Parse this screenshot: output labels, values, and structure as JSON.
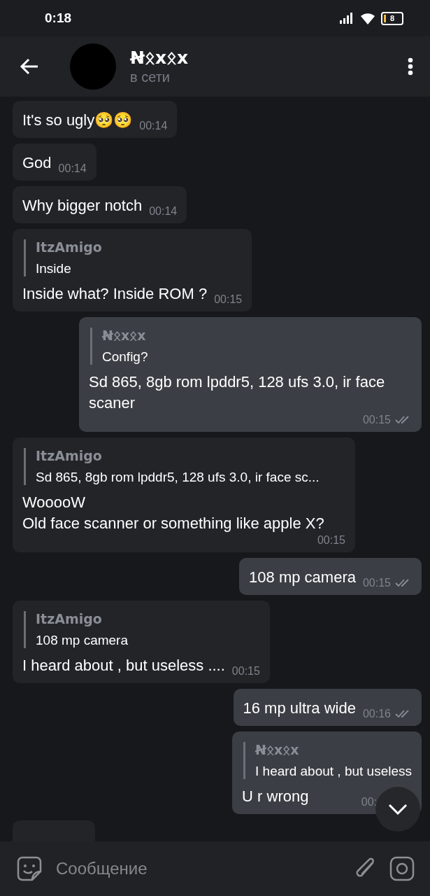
{
  "status_bar": {
    "time": "0:18",
    "battery": "8"
  },
  "header": {
    "name": "Ꞥᛟxᛟx",
    "status": "в сети"
  },
  "messages": [
    {
      "kind": "in",
      "text": "It's so ugly🥺🥺",
      "time": "00:14"
    },
    {
      "kind": "in",
      "text": "God",
      "time": "00:14"
    },
    {
      "kind": "in",
      "text": "Why bigger notch",
      "time": "00:14"
    },
    {
      "kind": "in",
      "reply": {
        "name": "ItzAmigo",
        "text": "Inside"
      },
      "text": "Inside what? Inside ROM ?",
      "time": "00:15"
    },
    {
      "kind": "out",
      "reply": {
        "name": "Ꞥᛟxᛟx",
        "text": "Config?"
      },
      "text": "Sd 865, 8gb rom lpddr5, 128 ufs 3.0, ir face scaner",
      "time": "00:15",
      "read": true
    },
    {
      "kind": "in",
      "reply": {
        "name": "ItzAmigo",
        "text": "Sd 865, 8gb rom lpddr5, 128 ufs 3.0, ir face sc..."
      },
      "text": "WooooW\nOld face scanner or something like apple X?",
      "time": "00:15"
    },
    {
      "kind": "out",
      "text": "108 mp camera",
      "time": "00:15",
      "read": true
    },
    {
      "kind": "in",
      "reply": {
        "name": "ItzAmigo",
        "text": "108 mp camera"
      },
      "text": "I heard about , but useless ....",
      "time": "00:15"
    },
    {
      "kind": "out",
      "text": "16 mp ultra wide",
      "time": "00:16",
      "read": true
    },
    {
      "kind": "out",
      "reply": {
        "name": "Ꞥᛟxᛟx",
        "text": "I heard about , but useless"
      },
      "text": "U r wrong",
      "time": "00:"
    }
  ],
  "composer": {
    "placeholder": "Сообщение"
  }
}
